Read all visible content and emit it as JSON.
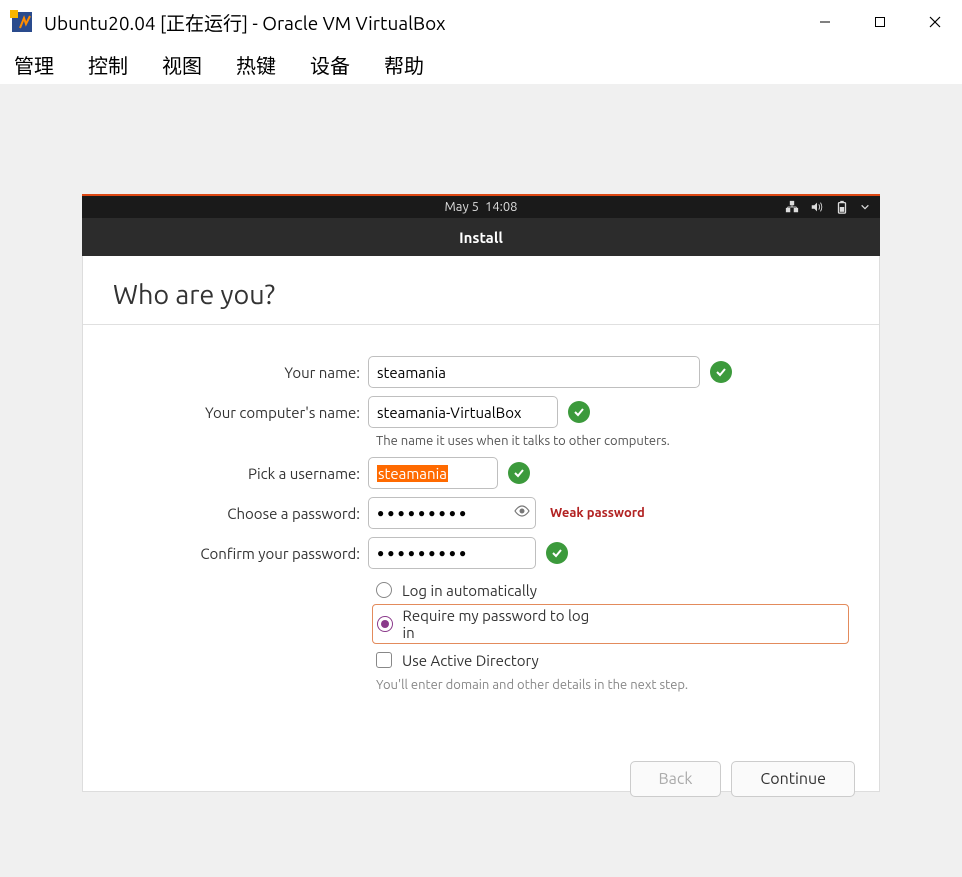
{
  "window": {
    "title": "Ubuntu20.04 [正在运行] - Oracle VM VirtualBox"
  },
  "menubar": {
    "items": [
      "管理",
      "控制",
      "视图",
      "热键",
      "设备",
      "帮助"
    ]
  },
  "topbar": {
    "date": "May 5",
    "time": "14:08"
  },
  "installer": {
    "header": "Install",
    "title": "Who are you?",
    "labels": {
      "name": "Your name:",
      "computer": "Your computer's name:",
      "username": "Pick a username:",
      "password": "Choose a password:",
      "confirm": "Confirm your password:"
    },
    "values": {
      "name": "steamania",
      "computer": "steamania-VirtualBox",
      "username": "steamania",
      "password_mask": "●●●●●●●●●",
      "confirm_mask": "●●●●●●●●●"
    },
    "hints": {
      "computer": "The name it uses when it talks to other computers.",
      "active_directory": "You'll enter domain and other details in the next step."
    },
    "password_strength": "Weak password",
    "options": {
      "auto_login": "Log in automatically",
      "require_pw": "Require my password to log in",
      "active_directory": "Use Active Directory"
    },
    "buttons": {
      "back": "Back",
      "continue": "Continue"
    }
  }
}
